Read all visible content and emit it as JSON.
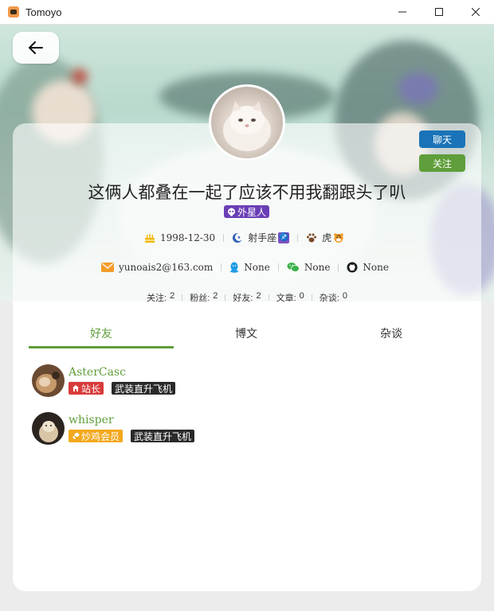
{
  "window": {
    "title": "Tomoyo"
  },
  "profile": {
    "username": "这俩人都叠在一起了应该不用我翻跟头了叭",
    "role": "外星人",
    "birthday": "1998-12-30",
    "zodiac": "射手座",
    "zodiac_symbol": "♐",
    "chinese_zodiac": "虎",
    "email": "yunoais2@163.com",
    "qq": "None",
    "wechat": "None",
    "github": "None"
  },
  "actions": {
    "chat_label": "聊天",
    "follow_label": "关注"
  },
  "stats": [
    {
      "label": "关注:",
      "value": "2"
    },
    {
      "label": "粉丝:",
      "value": "2"
    },
    {
      "label": "好友:",
      "value": "2"
    },
    {
      "label": "文章:",
      "value": "0"
    },
    {
      "label": "杂谈:",
      "value": "0"
    }
  ],
  "tabs": [
    {
      "label": "好友",
      "active": true
    },
    {
      "label": "博文",
      "active": false
    },
    {
      "label": "杂谈",
      "active": false
    }
  ],
  "friends": [
    {
      "name": "AsterCasc",
      "badge": "站长",
      "badge_color": "#d93b3b",
      "title": "武装直升飞机"
    },
    {
      "name": "whisper",
      "badge": "炒鸡会员",
      "badge_color": "#f2a81d",
      "title": "武装直升飞机"
    }
  ],
  "colors": {
    "accent": "#5f9e3a",
    "chat_button": "#1a73b8",
    "role_tag": "#6a3fb5"
  }
}
